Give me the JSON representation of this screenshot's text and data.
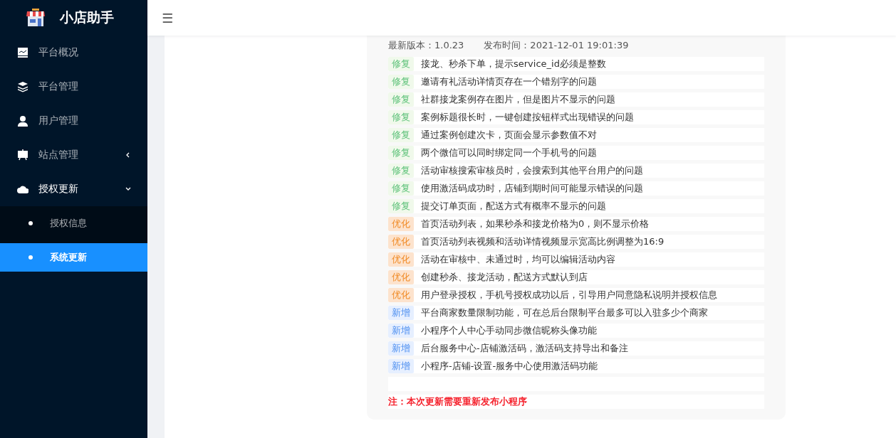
{
  "sidebar": {
    "logo_text": "小店助手",
    "items": [
      {
        "label": "平台概况",
        "kind": "link"
      },
      {
        "label": "平台管理",
        "kind": "link"
      },
      {
        "label": "用户管理",
        "kind": "link"
      },
      {
        "label": "站点管理",
        "kind": "group",
        "expanded": false
      },
      {
        "label": "授权更新",
        "kind": "group",
        "expanded": true,
        "children": [
          {
            "label": "授权信息",
            "selected": false
          },
          {
            "label": "系统更新",
            "selected": true
          }
        ]
      }
    ]
  },
  "header": {
    "menu_icon": "☰"
  },
  "release": {
    "version_label": "最新版本：1.0.23",
    "time_label": "发布时间：2021-12-01 19:01:39",
    "changes": [
      {
        "kind": "fix",
        "tag": "修复",
        "text": "接龙、秒杀下单，提示service_id必须是整数"
      },
      {
        "kind": "fix",
        "tag": "修复",
        "text": "邀请有礼活动详情页存在一个错别字的问题"
      },
      {
        "kind": "fix",
        "tag": "修复",
        "text": "社群接龙案例存在图片，但是图片不显示的问题"
      },
      {
        "kind": "fix",
        "tag": "修复",
        "text": "案例标题很长时，一键创建按钮样式出现错误的问题"
      },
      {
        "kind": "fix",
        "tag": "修复",
        "text": "通过案例创建次卡，页面会显示参数值不对"
      },
      {
        "kind": "fix",
        "tag": "修复",
        "text": "两个微信可以同时绑定同一个手机号的问题"
      },
      {
        "kind": "fix",
        "tag": "修复",
        "text": "活动审核搜索审核员时，会搜索到其他平台用户的问题"
      },
      {
        "kind": "fix",
        "tag": "修复",
        "text": "使用激活码成功时，店铺到期时间可能显示错误的问题"
      },
      {
        "kind": "fix",
        "tag": "修复",
        "text": "提交订单页面，配送方式有概率不显示的问题"
      },
      {
        "kind": "optimize",
        "tag": "优化",
        "text": "首页活动列表，如果秒杀和接龙价格为0，则不显示价格"
      },
      {
        "kind": "optimize",
        "tag": "优化",
        "text": "首页活动列表视频和活动详情视频显示宽高比例调整为16:9"
      },
      {
        "kind": "optimize",
        "tag": "优化",
        "text": "活动在审核中、未通过时，均可以编辑活动内容"
      },
      {
        "kind": "optimize",
        "tag": "优化",
        "text": "创建秒杀、接龙活动，配送方式默认到店"
      },
      {
        "kind": "optimize",
        "tag": "优化",
        "text": "用户登录授权，手机号授权成功以后，引导用户同意隐私说明并授权信息"
      },
      {
        "kind": "add",
        "tag": "新增",
        "text": "平台商家数量限制功能，可在总后台限制平台最多可以入驻多少个商家"
      },
      {
        "kind": "add",
        "tag": "新增",
        "text": "小程序个人中心手动同步微信昵称头像功能"
      },
      {
        "kind": "add",
        "tag": "新增",
        "text": "后台服务中心-店铺激活码，激活码支持导出和备注"
      },
      {
        "kind": "add",
        "tag": "新增",
        "text": "小程序-店铺-设置-服务中心使用激活码功能"
      }
    ],
    "note": "注：本次更新需要重新发布小程序"
  }
}
